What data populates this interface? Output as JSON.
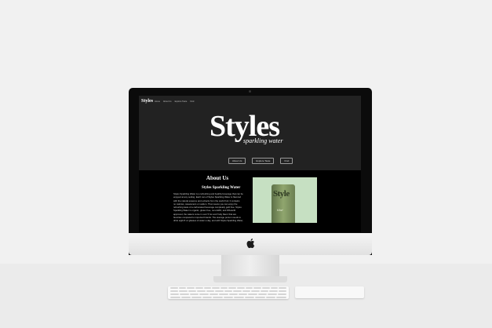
{
  "site": {
    "logo": "Styles",
    "nav": [
      "Home",
      "About Us",
      "Explore Taste",
      "Find"
    ],
    "brand": "Styles",
    "tagline": "sparkling water",
    "buttons": [
      "About Us",
      "Explore Taste",
      "Find"
    ]
  },
  "about": {
    "title": "About Us",
    "subtitle": "Styles Sparkling Water",
    "body_lines": [
      "Styles Sparkling Water is a refreshing and healthy beverage that can be",
      "enjoyed at any setting. Each can of Styles Sparkling Water is flavored",
      "with the natural essence and extracts from the world fruit. It contains",
      "no calories, sweeteners or sodium. That means you can enjoy the",
      "refreshing taste of a carbonated beverage completely guilt free. Styles",
      "Sparkling Water is organic, gluten free, non-GMO, and Whole30",
      "approved, the waters come in over 5 fun and fruity flavor that are",
      "favorites compared to imported brands. The average person needs to",
      "drink eight 8 oz glasses of water a day, and with Styles Sparkling Water,"
    ],
    "product": {
      "can_brand": "Style",
      "can_flavor": "Kiwi"
    }
  },
  "colors": {
    "hero_bg": "#222222",
    "section_bg": "#000000",
    "product_bg": "#c6e0c2"
  }
}
